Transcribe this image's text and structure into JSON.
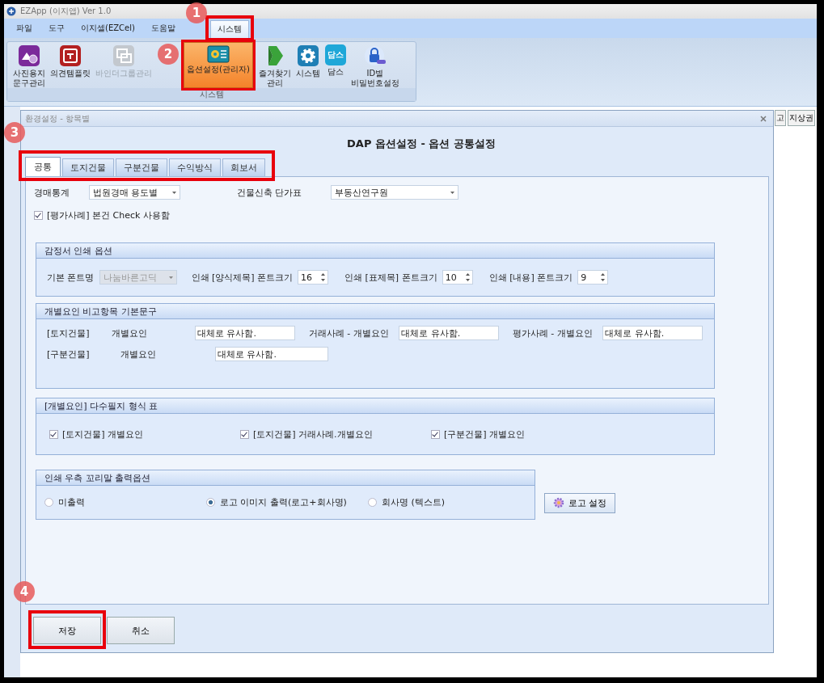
{
  "window": {
    "title": "EZApp (이지앱)  Ver 1.0"
  },
  "menu": [
    {
      "label": "파일",
      "selected": false
    },
    {
      "label": "도구",
      "selected": false
    },
    {
      "label": "이지셀(EZCel)",
      "selected": false
    },
    {
      "label": "도움말",
      "selected": false
    },
    {
      "label": "시스템",
      "selected": true
    }
  ],
  "ribbon": {
    "group_label": "시스템",
    "items": [
      {
        "lines": [
          "사진용지",
          "문구관리"
        ],
        "selected": false,
        "disabled": false
      },
      {
        "lines": [
          "의견템플릿"
        ],
        "selected": false,
        "disabled": false
      },
      {
        "lines": [
          "바인더그룹관리"
        ],
        "selected": false,
        "disabled": true
      },
      {
        "lines": [
          "옵션설정(관리자)"
        ],
        "selected": true,
        "disabled": false
      },
      {
        "lines": [
          "즐겨찾기",
          "관리"
        ],
        "selected": false,
        "disabled": false
      },
      {
        "lines": [
          "시스템"
        ],
        "selected": false,
        "disabled": false
      },
      {
        "lines": [
          "담스"
        ],
        "selected": false,
        "disabled": false,
        "icon_text": "담스"
      },
      {
        "lines": [
          "ID별",
          "비밀번호설정"
        ],
        "selected": false,
        "disabled": false
      }
    ]
  },
  "background_buttons": [
    "고",
    "지상권"
  ],
  "dialog": {
    "title": "환경설정 - 항목별",
    "heading": "DAP 옵션설정 - 옵션 공통설정",
    "tabs": [
      {
        "label": "공통",
        "selected": true
      },
      {
        "label": "토지건물",
        "selected": false
      },
      {
        "label": "구분건물",
        "selected": false
      },
      {
        "label": "수익방식",
        "selected": false
      },
      {
        "label": "회보서",
        "selected": false
      }
    ],
    "top_fields": [
      {
        "label": "경매통계",
        "value": "법원경매 용도별"
      },
      {
        "label": "건물신축 단가표",
        "value": "부동산연구원"
      }
    ],
    "top_checkbox": {
      "label": "[평가사례] 본건 Check 사용함",
      "checked": true
    },
    "print_group": {
      "title": "감정서 인쇄 옵션",
      "font_label": "기본 폰트명",
      "font_value": "나눔바른고딕",
      "font_disabled": true,
      "spinners": [
        {
          "label": "인쇄 [양식제목] 폰트크기",
          "value": "16"
        },
        {
          "label": "인쇄 [표제목] 폰트크기",
          "value": "10"
        },
        {
          "label": "인쇄 [내용] 폰트크기",
          "value": "9"
        }
      ]
    },
    "factor_group": {
      "title": "개별요인 비고항목 기본문구",
      "rows": [
        {
          "category": "[토지건물]",
          "fields": [
            {
              "label": "개별요인",
              "value": "대체로 유사함."
            },
            {
              "label": "거래사례 - 개별요인",
              "value": "대체로 유사함."
            },
            {
              "label": "평가사례 - 개별요인",
              "value": "대체로 유사함."
            }
          ]
        },
        {
          "category": "[구분건물]",
          "fields": [
            {
              "label": "개별요인",
              "value": "대체로 유사함."
            }
          ]
        }
      ]
    },
    "table_group": {
      "title": "[개별요인] 다수필지 형식 표",
      "checkboxes": [
        {
          "label": "[토지건물] 개별요인",
          "checked": true
        },
        {
          "label": "[토지건물] 거래사례.개별요인",
          "checked": true
        },
        {
          "label": "[구분건물] 개별요인",
          "checked": true
        }
      ]
    },
    "footer_group": {
      "title": "인쇄 우측 꼬리말 출력옵션",
      "radios": [
        {
          "label": "미출력",
          "selected": false
        },
        {
          "label": "로고 이미지 출력(로고+회사명)",
          "selected": true
        },
        {
          "label": "회사명 (텍스트)",
          "selected": false
        }
      ]
    },
    "logo_button": "로고 설정",
    "buttons": [
      "저장",
      "취소"
    ]
  },
  "annotations": [
    {
      "label": "1"
    },
    {
      "label": "2"
    },
    {
      "label": "3"
    },
    {
      "label": "4"
    }
  ]
}
